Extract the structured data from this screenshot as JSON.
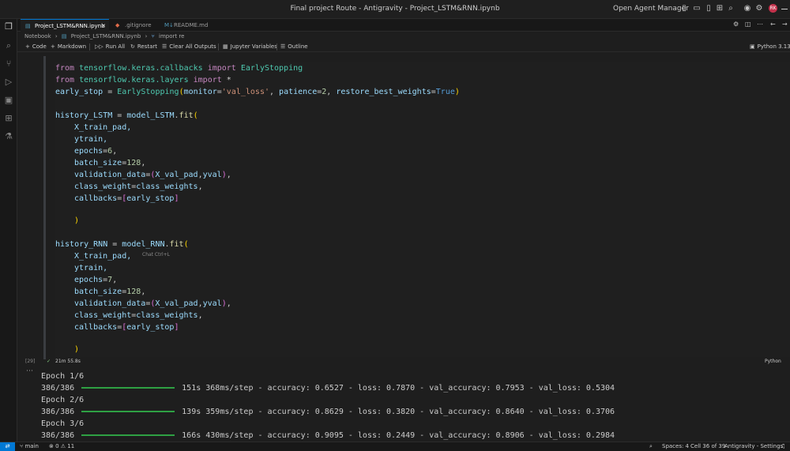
{
  "window": {
    "title": "Final project Route - Antigravity - Project_LSTM&RNN.ipynb",
    "agent_manager": "Open Agent Manager",
    "avatar_initials": "RK"
  },
  "tabs": [
    {
      "label": "Project_LSTM&RNN.ipynb",
      "icon": "notebook-icon",
      "active": true
    },
    {
      "label": ".gitignore",
      "icon": "git-icon",
      "active": false
    },
    {
      "label": "README.md",
      "icon": "markdown-icon",
      "active": false
    }
  ],
  "breadcrumb": [
    "Notebook",
    "Project_LSTM&RNN.ipynb",
    "import re"
  ],
  "toolbar": {
    "code": "Code",
    "markdown": "Markdown",
    "run_all": "Run All",
    "restart": "Restart",
    "clear_outputs": "Clear All Outputs",
    "variables": "Jupyter Variables",
    "outline": "Outline",
    "kernel": "Python 3.13.8"
  },
  "cell": {
    "exec_count": "[29]",
    "duration": "21m 55.8s",
    "language": "Python",
    "chat_hint": "Chat Ctrl+L"
  },
  "code": {
    "l1_kw": "from",
    "l1_mod": "tensorflow.keras.callbacks",
    "l1_kw2": "import",
    "l1_name": "EarlyStopping",
    "l2_kw": "from",
    "l2_mod": "tensorflow.keras.layers",
    "l2_kw2": "import",
    "l2_name": "*",
    "l3_var": "early_stop",
    "l3_eq": " = ",
    "l3_fn": "EarlyStopping",
    "l3_p1": "monitor",
    "l3_s1": "'val_loss'",
    "l3_p2": "patience",
    "l3_n1": "2",
    "l3_p3": "restore_best_weights",
    "l3_b1": "True",
    "l4_var": "history_LSTM",
    "l4_obj": "model_LSTM",
    "l4_fn": "fit",
    "l5": "X_train_pad,",
    "l6": "ytrain,",
    "l7_p": "epochs",
    "l7_n": "6",
    "l8_p": "batch_size",
    "l8_n": "128",
    "l9_p": "validation_data",
    "l9_a": "X_val_pad",
    "l9_b": "yval",
    "l10_p": "class_weight",
    "l10_v": "class_weights",
    "l11_p": "callbacks",
    "l11_v": "early_stop",
    "l12": ")",
    "l13_var": "history_RNN",
    "l13_obj": "model_RNN",
    "l13_fn": "fit",
    "l14": "X_train_pad,",
    "l15": "ytrain,",
    "l16_p": "epochs",
    "l16_n": "7",
    "l17_p": "batch_size",
    "l17_n": "128",
    "l18_p": "validation_data",
    "l18_a": "X_val_pad",
    "l18_b": "yval",
    "l19_p": "class_weight",
    "l19_v": "class_weights",
    "l20_p": "callbacks",
    "l20_v": "early_stop",
    "l21": ")"
  },
  "output": [
    {
      "epoch": "Epoch 1/6",
      "steps": "386/386",
      "stats": "151s 368ms/step - accuracy: 0.6527 - loss: 0.7870 - val_accuracy: 0.7953 - val_loss: 0.5304"
    },
    {
      "epoch": "Epoch 2/6",
      "steps": "386/386",
      "stats": "139s 359ms/step - accuracy: 0.8629 - loss: 0.3820 - val_accuracy: 0.8640 - val_loss: 0.3706"
    },
    {
      "epoch": "Epoch 3/6",
      "steps": "386/386",
      "stats": "166s 430ms/step - accuracy: 0.9095 - loss: 0.2449 - val_accuracy: 0.8906 - val_loss: 0.2984"
    }
  ],
  "statusbar": {
    "branch": "main",
    "errors": "0",
    "warnings": "11",
    "spaces": "Spaces: 4",
    "cell": "Cell 36 of 39",
    "settings": "Antigravity - Settings"
  },
  "colors": {
    "accent": "#0078d4",
    "progress": "#2ea043",
    "error": "#c4314b"
  }
}
